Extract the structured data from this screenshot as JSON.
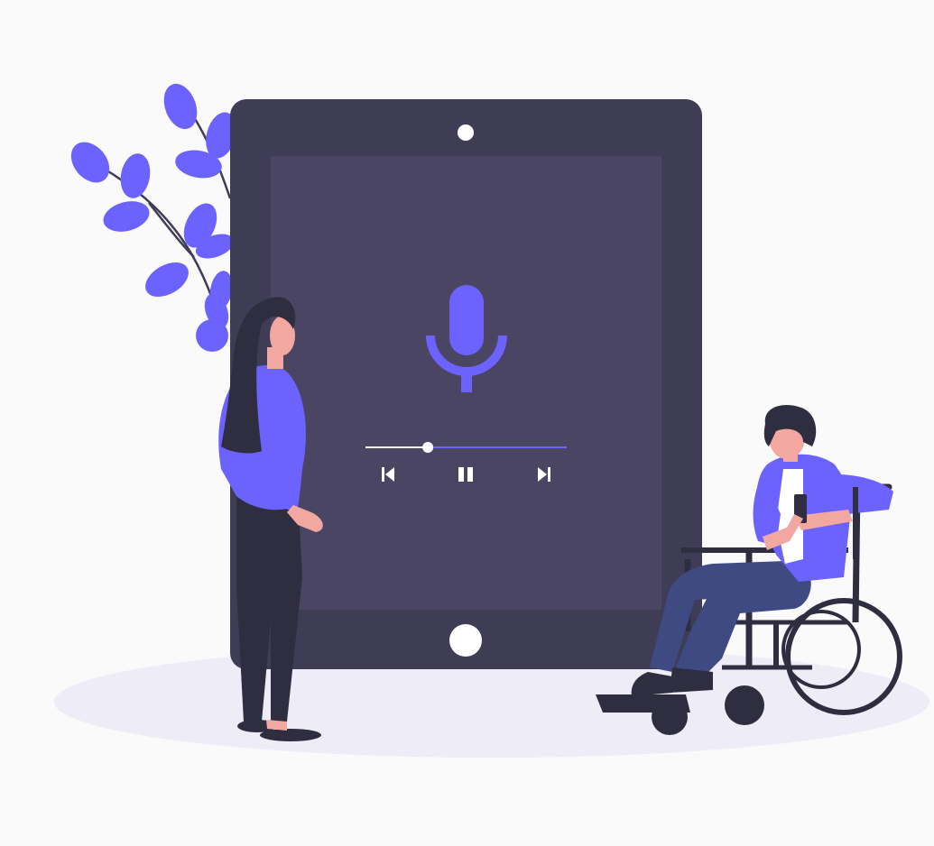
{
  "illustration": {
    "subject": "voice-recorder-tablet",
    "colors": {
      "background": "#fafafa",
      "ground_ellipse": "#edecf7",
      "tablet_frame": "#3f3d56",
      "tablet_screen": "#4a4563",
      "accent": "#6c63ff",
      "home_button": "#ffffff",
      "camera": "#ffffff",
      "track_played": "#ffffff",
      "track_remaining": "#6c63ff",
      "skin": "#f2a7a0",
      "hair_dark": "#2f2e41",
      "pants_dark": "#2f2e41",
      "jeans": "#3f4a82",
      "shirt_white": "#ffffff",
      "wheelchair": "#2f2e41",
      "leaf_stem": "#3f3d56"
    },
    "player": {
      "progress": 0.31,
      "icons": {
        "record": "microphone-icon",
        "previous": "skip-previous-icon",
        "pause": "pause-icon",
        "next": "skip-next-icon"
      }
    }
  }
}
